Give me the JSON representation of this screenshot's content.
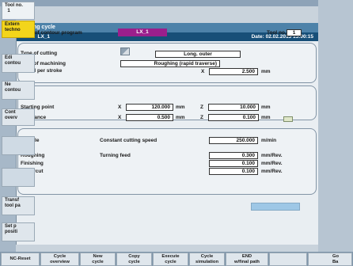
{
  "window": {
    "title": "Cutting cycle",
    "name_label": "Name:",
    "name_value": "LX_1",
    "date_label": "Date:",
    "date_value": "02.02.2015 15:00:15"
  },
  "program": {
    "label": "Name of contour program",
    "value": "LX_1",
    "tool_label": "Tool no.",
    "tool_value": "1"
  },
  "cutting": {
    "type_label": "Type of cutting",
    "type_value": "Long. outer",
    "machining_label": "Type of machining",
    "machining_value": "Roughing (rapid traverse)",
    "infeed_label": "Infeed per stroke",
    "infeed_axis": "X",
    "infeed_value": "2.500",
    "infeed_unit": "mm"
  },
  "position": {
    "start_label": "Starting point",
    "start_x_axis": "X",
    "start_x_value": "120.000",
    "start_x_unit": "mm",
    "start_z_axis": "Z",
    "start_z_value": "10.000",
    "start_z_unit": "mm",
    "allow_label": "Allowance",
    "allow_x_axis": "X",
    "allow_x_value": "0.500",
    "allow_x_unit": "mm",
    "allow_z_axis": "Z",
    "allow_z_value": "0.100",
    "allow_z_unit": "mm"
  },
  "spindle": {
    "spindle_label": "Spindle",
    "spindle_mode": "Constant cutting speed",
    "spindle_value": "250.000",
    "spindle_unit": "m/min",
    "roughing_label": "Roughing",
    "feed_label": "Turning feed",
    "roughing_value": "0.300",
    "roughing_unit": "mm/Rev.",
    "finishing_label": "Finishing",
    "finishing_value": "0.100",
    "finishing_unit": "mm/Rev.",
    "undercut_label": "Undercut",
    "undercut_value": "0.100",
    "undercut_unit": "mm/Rev."
  },
  "right_softkeys": {
    "tool_no": "Tool no.\n  1",
    "external_tech": "Extern\ntechno",
    "edit_contour": "Edi\ncontou",
    "new_contour": "Ne\ncontou",
    "contour_overview": "Cont\noverv",
    "transfer_tool": "Transf\ntool pa",
    "set_position": "Set p\npositi"
  },
  "bottom_softkeys": {
    "nc_reset": "NC-Reset",
    "cycle_overview": "Cycle\noverview",
    "new_cycle": "New\ncycle",
    "copy_cycle": "Copy\ncycle",
    "execute_cycle": "Execute\ncycle",
    "cycle_simulation": "Cycle\nsimulation",
    "end": "END\nw/final path",
    "extra": "Go\nBa"
  },
  "colors": {
    "title_bar": "#4d82a9",
    "name_bar": "#174f78",
    "program_name": "#9b1f8c",
    "selected_softkey": "#f3d51b"
  }
}
